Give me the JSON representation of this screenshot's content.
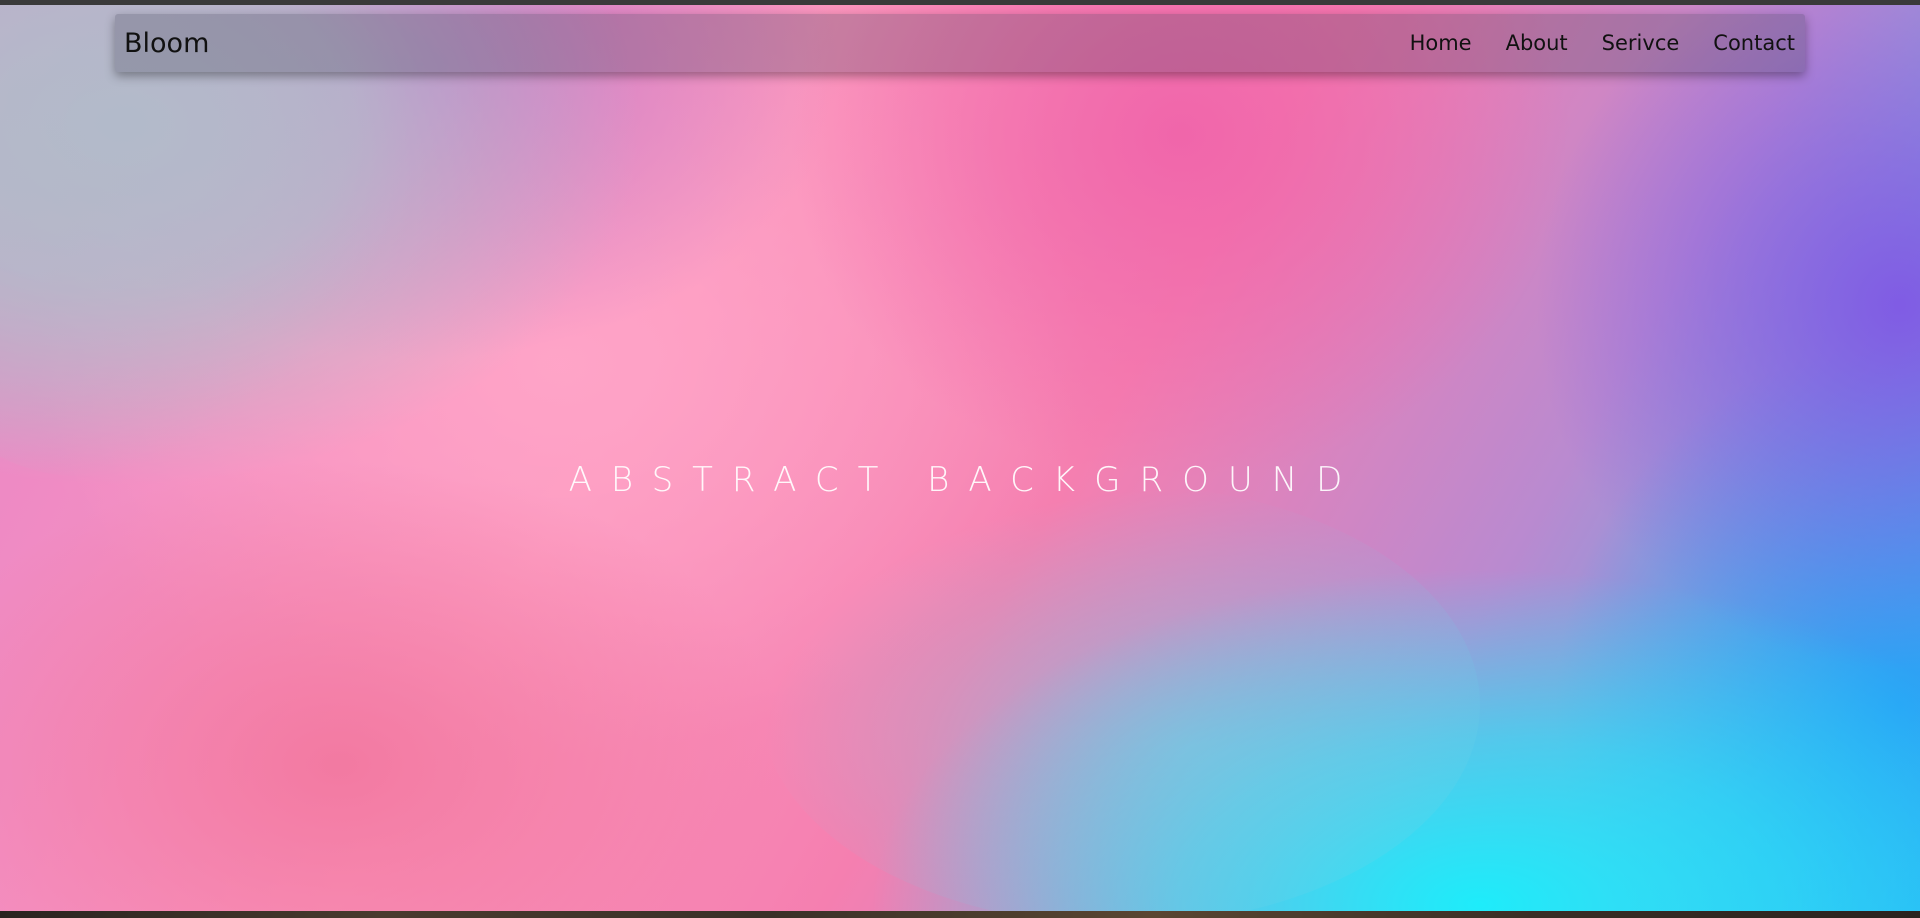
{
  "navbar": {
    "brand": "Bloom",
    "links": [
      {
        "label": "Home"
      },
      {
        "label": "About"
      },
      {
        "label": "Serivce"
      },
      {
        "label": "Contact"
      }
    ]
  },
  "hero": {
    "title": "ABSTRACT BACKGROUND"
  },
  "colors": {
    "gray": "#b0bec8",
    "pink": "#fb96bd",
    "magenta": "#f064aa",
    "purple": "#8058e4",
    "cyan": "#1eecfa",
    "blue": "#28a0f6"
  }
}
